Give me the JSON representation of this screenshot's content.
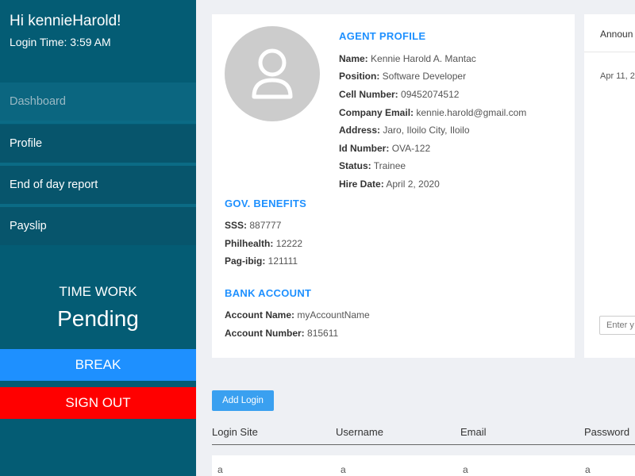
{
  "sidebar": {
    "greeting": "Hi kennieHarold!",
    "login_time": "Login Time: 3:59 AM",
    "nav": [
      "Dashboard",
      "Profile",
      "End of day report",
      "Payslip"
    ],
    "time_work_label": "TIME WORK",
    "time_work_status": "Pending",
    "break_label": "BREAK",
    "signout_label": "SIGN OUT"
  },
  "profile": {
    "agent_title": "AGENT PROFILE",
    "fields": [
      {
        "label": "Name:",
        "value": "Kennie Harold A. Mantac"
      },
      {
        "label": "Position:",
        "value": "Software Developer"
      },
      {
        "label": "Cell Number:",
        "value": "09452074512"
      },
      {
        "label": "Company Email:",
        "value": "kennie.harold@gmail.com"
      },
      {
        "label": "Address:",
        "value": "Jaro, Iloilo City, Iloilo"
      },
      {
        "label": "Id Number:",
        "value": "OVA-122"
      },
      {
        "label": "Status:",
        "value": "Trainee"
      },
      {
        "label": "Hire Date:",
        "value": "April 2, 2020"
      }
    ],
    "gov_title": "GOV. BENEFITS",
    "gov": [
      {
        "label": "SSS:",
        "value": "887777"
      },
      {
        "label": "Philhealth:",
        "value": "12222"
      },
      {
        "label": "Pag-ibig:",
        "value": "121111"
      }
    ],
    "bank_title": "BANK ACCOUNT",
    "bank": [
      {
        "label": "Account Name:",
        "value": "myAccountName"
      },
      {
        "label": "Account Number:",
        "value": "815611"
      }
    ]
  },
  "announcement": {
    "title": "Announ",
    "date": "Apr 11, 2",
    "input_placeholder": "Enter y"
  },
  "logins": {
    "add_label": "Add Login",
    "columns": [
      "Login Site",
      "Username",
      "Email",
      "Password"
    ],
    "rows": [
      [
        "a",
        "a",
        "a",
        "a"
      ]
    ]
  },
  "colors": {
    "sidebar": "#045c74",
    "accent": "#1e90ff",
    "danger": "#ff0000"
  }
}
